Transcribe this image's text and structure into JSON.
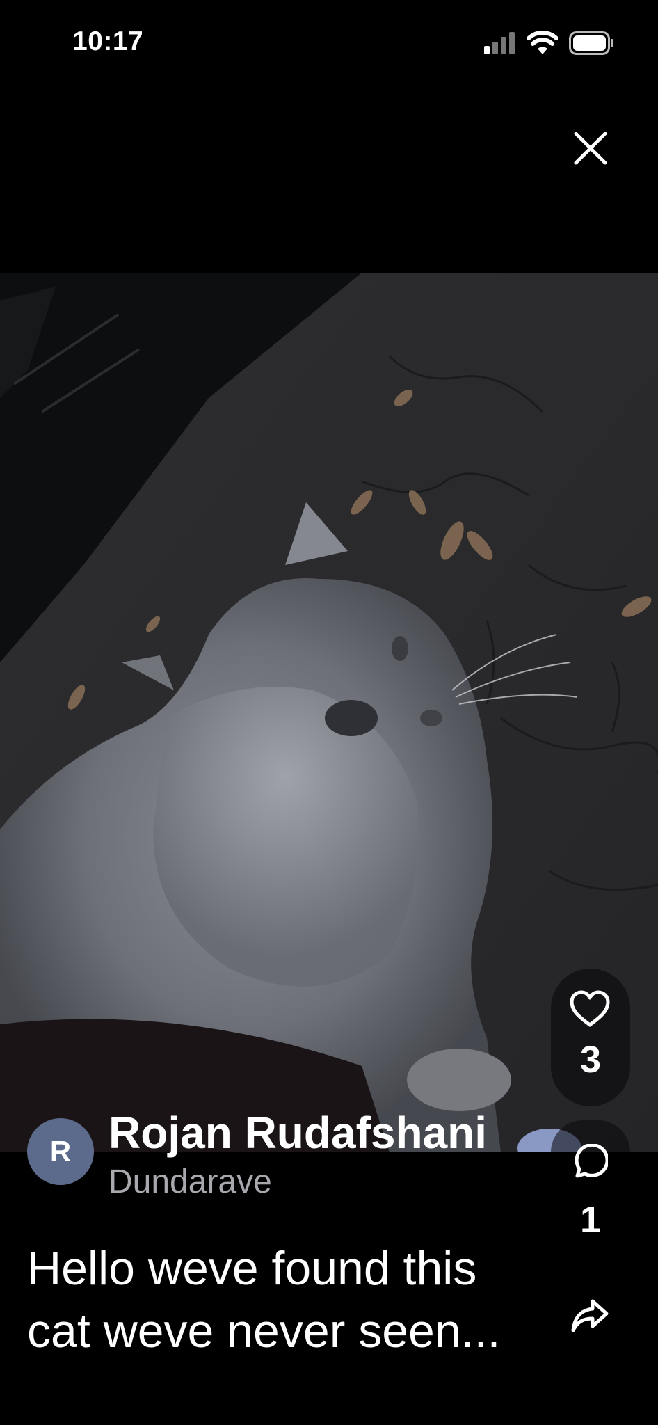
{
  "status_bar": {
    "time": "10:17",
    "icons": [
      "signal-icon",
      "wifi-icon",
      "battery-icon"
    ]
  },
  "close_icon": "close-icon",
  "photo": {
    "subject": "gray-cat-photo"
  },
  "actions": {
    "like_icon": "heart-icon",
    "like_count": "3",
    "comment_icon": "comment-bubble-icon",
    "comment_count": "1",
    "share_icon": "share-arrow-icon"
  },
  "author": {
    "initial": "R",
    "name": "Rojan Rudafshani",
    "location": "Dundarave",
    "avatar_color": "#5c6b8c"
  },
  "post": {
    "line1": "Hello weve found this",
    "line2": "cat weve never seen..."
  },
  "colors": {
    "background": "#000000",
    "text": "#ffffff",
    "secondary_text": "#a8a8ae"
  }
}
